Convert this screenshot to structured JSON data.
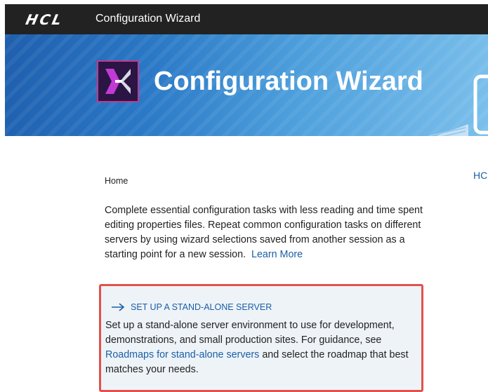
{
  "topbar": {
    "logo": "HCL",
    "app_title": "Configuration Wizard"
  },
  "banner": {
    "title": "Configuration Wizard",
    "product_icon": "x-logo-icon"
  },
  "breadcrumb": "Home",
  "right_link": "HC",
  "intro": {
    "text": "Complete essential configuration tasks with less reading and time spent editing properties files. Repeat common configuration tasks on different servers by using wizard selections saved from another session as a starting point for a new session.",
    "learn_more": "Learn More"
  },
  "card": {
    "icon": "arrow-right-icon",
    "heading": "SET UP A STAND-ALONE SERVER",
    "body_1": "Set up a stand-alone server environment to use for development, demonstrations, and small production sites. For guidance, see",
    "link": "Roadmaps for stand-alone servers",
    "body_2": "and select the roadmap that best matches your needs."
  },
  "colors": {
    "topbar": "#222222",
    "link": "#1a5fa6",
    "highlight_border": "#e2514c",
    "card_bg": "#eef3f8"
  }
}
